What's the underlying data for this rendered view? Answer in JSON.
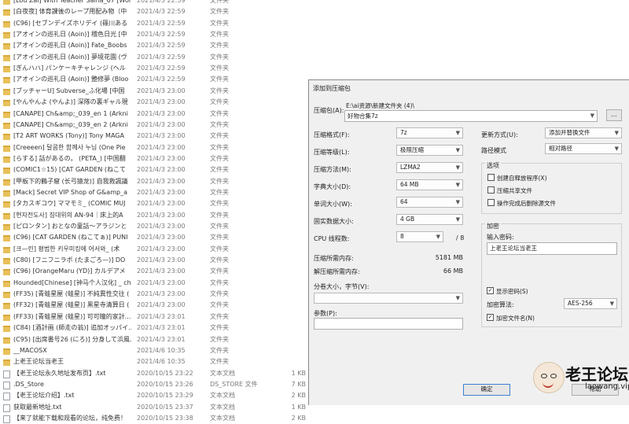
{
  "files": [
    {
      "name": "[Lou Zai] With Teacher Saina_07 [World Of",
      "date": "2021/4/3 22:59",
      "type": "文件夹",
      "size": "",
      "kind": "folder"
    },
    {
      "name": "[白夜夜] 体育課後のレープ用配み物（中",
      "date": "2021/4/3 22:59",
      "type": "文件夹",
      "size": "",
      "kind": "folder"
    },
    {
      "name": "(C96) [セブンデイズホリデイ (篠川ある",
      "date": "2021/4/3 22:59",
      "type": "文件夹",
      "size": "",
      "kind": "folder"
    },
    {
      "name": "[アオインの巡礼日 (Aoin)] 稽色日光 [中",
      "date": "2021/4/3 22:59",
      "type": "文件夹",
      "size": "",
      "kind": "folder"
    },
    {
      "name": "[アオインの巡礼日 (Aoin)] Fate_Boobs",
      "date": "2021/4/3 22:59",
      "type": "文件夹",
      "size": "",
      "kind": "folder"
    },
    {
      "name": "[アオインの巡礼日 (Aoin)] 夢境花園 (ヴ",
      "date": "2021/4/3 22:59",
      "type": "文件夹",
      "size": "",
      "kind": "folder"
    },
    {
      "name": "[ぎんハハ] パンケーキチャレンジ (ヘル",
      "date": "2021/4/3 22:59",
      "type": "文件夹",
      "size": "",
      "kind": "folder"
    },
    {
      "name": "[アオインの巡礼日 (Aoin)] 艷修夢 (Bloo",
      "date": "2021/4/3 22:59",
      "type": "文件夹",
      "size": "",
      "kind": "folder"
    },
    {
      "name": "[ブッチャーU] Subverse_ふ化場 [中国",
      "date": "2021/4/3 23:00",
      "type": "文件夹",
      "size": "",
      "kind": "folder"
    },
    {
      "name": "[やんやんよ (やんよ)] 深隊の裏ギャル現",
      "date": "2021/4/3 23:00",
      "type": "文件夹",
      "size": "",
      "kind": "folder"
    },
    {
      "name": "[CANAPE] Ch&amp;_039_en 1 (Arkni",
      "date": "2021/4/3 23:00",
      "type": "文件夹",
      "size": "",
      "kind": "folder"
    },
    {
      "name": "[CANAPE] Ch&amp;_039_en 2 (Arkni",
      "date": "2021/4/3 23:00",
      "type": "文件夹",
      "size": "",
      "kind": "folder"
    },
    {
      "name": "[T2 ART WORKS (Tony)] Tony MAGA",
      "date": "2021/4/3 23:00",
      "type": "文件夹",
      "size": "",
      "kind": "folder"
    },
    {
      "name": "[Creeeen] 달콤한 함께사 누님 (One Pie",
      "date": "2021/4/3 23:00",
      "type": "文件夹",
      "size": "",
      "kind": "folder"
    },
    {
      "name": "[らする] 話があるの。 (PETA_) [中国翻",
      "date": "2021/4/3 23:00",
      "type": "文件夹",
      "size": "",
      "kind": "folder"
    },
    {
      "name": "(COMIC1☆15) [CAT GARDEN (ねこて",
      "date": "2021/4/3 23:00",
      "type": "文件夹",
      "size": "",
      "kind": "folder"
    },
    {
      "name": "[甲板下的鶴子窟 (长弓猿龙)] 自我救諷議",
      "date": "2021/4/3 23:00",
      "type": "文件夹",
      "size": "",
      "kind": "folder"
    },
    {
      "name": "[Mack] Secret VIP Shop of G&amp_a",
      "date": "2021/4/3 23:00",
      "type": "文件夹",
      "size": "",
      "kind": "folder"
    },
    {
      "name": "[タカスギコウ] ママモミ_ (COMIC MUJ",
      "date": "2021/4/3 23:00",
      "type": "文件夹",
      "size": "",
      "kind": "folder"
    },
    {
      "name": "[현자전도사] 징대위의 AN-94｜床上的A",
      "date": "2021/4/3 23:00",
      "type": "文件夹",
      "size": "",
      "kind": "folder"
    },
    {
      "name": "[ピロンタン] おとなの童話～アラジンと",
      "date": "2021/4/3 23:00",
      "type": "文件夹",
      "size": "",
      "kind": "folder"
    },
    {
      "name": "(C96) [CAT GARDEN (ねこてぁ)] PUNI",
      "date": "2021/4/3 23:00",
      "type": "文件夹",
      "size": "",
      "kind": "folder"
    },
    {
      "name": "[크—린] 평범한 키우미킹에 어서와_ (术",
      "date": "2021/4/3 23:00",
      "type": "文件夹",
      "size": "",
      "kind": "folder"
    },
    {
      "name": "(C80) [フニフニラボ (たまごろ—)] DO",
      "date": "2021/4/3 23:00",
      "type": "文件夹",
      "size": "",
      "kind": "folder"
    },
    {
      "name": "(C96) [OrangeMaru (YD)] カルデアメ",
      "date": "2021/4/3 23:00",
      "type": "文件夹",
      "size": "",
      "kind": "folder"
    },
    {
      "name": "Hounded[Chinese] [钟马个人汉化] _ ch",
      "date": "2021/4/3 23:00",
      "type": "文件夹",
      "size": "",
      "kind": "folder"
    },
    {
      "name": "(FF35) [青蛙星屋 (蛙星)] 不純異性交往 (",
      "date": "2021/4/3 23:00",
      "type": "文件夹",
      "size": "",
      "kind": "folder"
    },
    {
      "name": "(FF32) [青蛙星屋 (蛙星)] 黑星寺清算日 (",
      "date": "2021/4/3 23:00",
      "type": "文件夹",
      "size": "",
      "kind": "folder"
    },
    {
      "name": "(FF33) [青蛙星屋 (蛙星)] 可可瞳的家計...",
      "date": "2021/4/3 23:01",
      "type": "文件夹",
      "size": "",
      "kind": "folder"
    },
    {
      "name": "(C84) [酒計画 (師走の翁)] 追加オッパイ...",
      "date": "2021/4/3 23:01",
      "type": "文件夹",
      "size": "",
      "kind": "folder"
    },
    {
      "name": "(C95) [出席番号26 (にろ)] 分身して浜風...",
      "date": "2021/4/3 23:01",
      "type": "文件夹",
      "size": "",
      "kind": "folder"
    },
    {
      "name": "__MACOSX",
      "date": "2021/4/6 10:35",
      "type": "文件夹",
      "size": "",
      "kind": "folder"
    },
    {
      "name": "上老王论坛当老王",
      "date": "2021/4/6 10:35",
      "type": "文件夹",
      "size": "",
      "kind": "folder"
    },
    {
      "name": "【老王论坛永久地址发布页】.txt",
      "date": "2020/10/15 23:22",
      "type": "文本文档",
      "size": "1 KB",
      "kind": "file"
    },
    {
      "name": ".DS_Store",
      "date": "2020/10/15 23:26",
      "type": "DS_STORE 文件",
      "size": "7 KB",
      "kind": "file"
    },
    {
      "name": "【老王论坛介绍】.txt",
      "date": "2020/10/15 23:29",
      "type": "文本文档",
      "size": "2 KB",
      "kind": "file"
    },
    {
      "name": "获取最新地址.txt",
      "date": "2020/10/15 23:37",
      "type": "文本文档",
      "size": "1 KB",
      "kind": "file"
    },
    {
      "name": "【来了就能下载和观看的论坛，纯免费！",
      "date": "2020/10/15 23:38",
      "type": "文本文档",
      "size": "2 KB",
      "kind": "file"
    }
  ],
  "dialog": {
    "title": "添加到压缩包",
    "archive_label": "压缩包(A):",
    "archive_path": "E:\\ai资源\\新建文件夹 (4)\\",
    "archive_name": "好物合集7z",
    "browse_label": "...",
    "format_label": "压缩格式(F):",
    "format_value": "7z",
    "level_label": "压缩等级(L):",
    "level_value": "极限压缩",
    "method_label": "压缩方法(M):",
    "method_value": "LZMA2",
    "dict_label": "字典大小(D):",
    "dict_value": "64 MB",
    "word_label": "单词大小(W):",
    "word_value": "64",
    "solid_label": "固实数据大小:",
    "solid_value": "4 GB",
    "cpu_label": "CPU 线程数:",
    "cpu_value": "8",
    "cpu_total": "/ 8",
    "mem_comp_label": "压缩所需内存:",
    "mem_comp_value": "5181 MB",
    "mem_decomp_label": "解压缩所需内存:",
    "mem_decomp_value": "66 MB",
    "split_label": "分卷大小，字节(V):",
    "params_label": "参数(P):",
    "update_label": "更新方式(U):",
    "update_value": "添加并替换文件",
    "path_label": "路径模式",
    "path_value": "相对路径",
    "options_title": "选项",
    "opt_sfx": "创建自释放程序(X)",
    "opt_shared": "压缩共享文件",
    "opt_delete": "操作完成后删除源文件",
    "enc_title": "加密",
    "pwd_label": "输入密码:",
    "pwd_value": "上老王论坛当老王",
    "show_pwd": "显示密码(S)",
    "enc_method_label": "加密算法:",
    "enc_method_value": "AES-256",
    "enc_names": "加密文件名(N)",
    "ok_label": "确定",
    "help_label": "帮助"
  },
  "watermark": {
    "title": "老王论坛",
    "url": "laowang.vip"
  }
}
